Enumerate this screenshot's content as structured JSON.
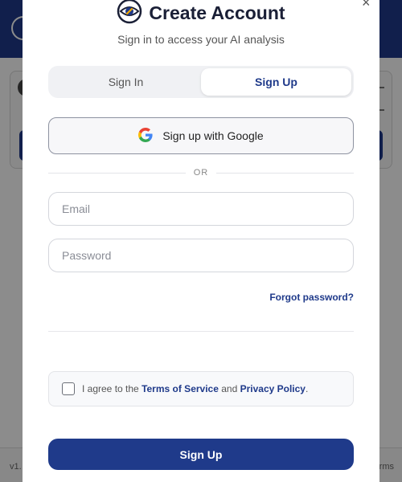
{
  "background": {
    "footer_left": "v1.",
    "footer_right": "rms"
  },
  "modal": {
    "close_label": "×",
    "title": "Create Account",
    "subtitle": "Sign in to access your AI analysis",
    "tabs": [
      {
        "label": "Sign In",
        "active": false
      },
      {
        "label": "Sign Up",
        "active": true
      }
    ],
    "google_button": "Sign up with Google",
    "divider": "OR",
    "email": {
      "placeholder": "Email",
      "value": ""
    },
    "password": {
      "placeholder": "Password",
      "value": ""
    },
    "forgot_password": "Forgot password?",
    "terms": {
      "checked": false,
      "prefix": "I agree to the ",
      "tos": "Terms of Service",
      "middle": " and ",
      "privacy": "Privacy Policy",
      "suffix": "."
    },
    "submit": "Sign Up"
  },
  "icons": {
    "logo": "eye-logo-icon",
    "google": "google-g-icon",
    "close": "close-icon"
  },
  "colors": {
    "primary": "#1f3a8a",
    "text": "#1a1f36"
  }
}
